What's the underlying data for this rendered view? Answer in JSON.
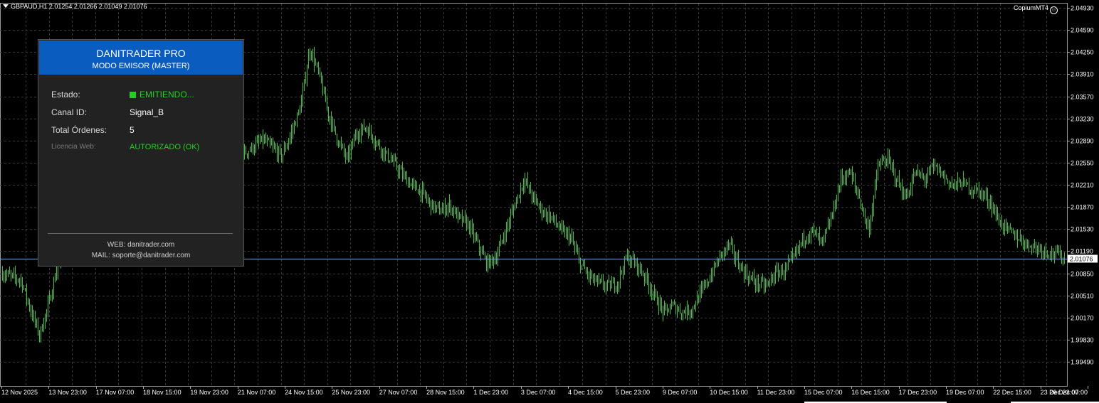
{
  "header": {
    "symbol_line": "GBPAUD,H1  2.01254 2.01266 2.01049 2.01076",
    "brand": "CopiumMT4"
  },
  "panel": {
    "title": "DANITRADER PRO",
    "subtitle": "MODO EMISOR (MASTER)",
    "estado_label": "Estado:",
    "estado_value": "EMITIENDO...",
    "canal_label": "Canal ID:",
    "canal_value": "Signal_B",
    "total_label": "Total Órdenes:",
    "total_value": "5",
    "licencia_label": "Licencia Web:",
    "licencia_value": "AUTORIZADO (OK)",
    "web": "WEB: danitrader.com",
    "mail": "MAIL: soporte@danitrader.com"
  },
  "colors": {
    "background": "#000000",
    "grid": "#3a3a3a",
    "bars": "#22d022",
    "price_line": "#7fa6c8",
    "panel_head": "#0b5cbf",
    "status_green": "#22d022"
  },
  "chart_data": {
    "type": "bar",
    "title": "GBPAUD,H1",
    "current_price": "2.01076",
    "y_ticks": [
      "2.04930",
      "2.04590",
      "2.04250",
      "2.03910",
      "2.03570",
      "2.03230",
      "2.02890",
      "2.02550",
      "2.02210",
      "2.01870",
      "2.01530",
      "2.01190",
      "2.00850",
      "2.00510",
      "2.00170",
      "1.99830",
      "1.99490"
    ],
    "ylim": [
      1.9949,
      2.0493
    ],
    "x_labels": [
      "12 Nov 2025",
      "13 Nov 23:00",
      "17 Nov 07:00",
      "18 Nov 15:00",
      "19 Nov 23:00",
      "21 Nov 07:00",
      "24 Nov 15:00",
      "25 Nov 23:00",
      "27 Nov 07:00",
      "28 Nov 15:00",
      "1 Dec 23:00",
      "3 Dec 07:00",
      "4 Dec 15:00",
      "5 Dec 23:00",
      "9 Dec 07:00",
      "10 Dec 15:00",
      "11 Dec 23:00",
      "15 Dec 07:00",
      "16 Dec 15:00",
      "17 Dec 23:00",
      "19 Dec 07:00",
      "22 Dec 15:00",
      "23 Dec 23:00",
      "26 Dec 07:00"
    ],
    "close_path": [
      [
        0,
        2.0085
      ],
      [
        2,
        2.0075
      ],
      [
        3,
        2.003
      ],
      [
        4,
        1.999
      ],
      [
        5,
        2.004
      ],
      [
        6,
        2.01
      ],
      [
        8,
        2.013
      ],
      [
        10,
        2.012
      ],
      [
        12,
        2.014
      ],
      [
        14,
        2.018
      ],
      [
        16,
        2.023
      ],
      [
        18,
        2.026
      ],
      [
        20,
        2.028
      ],
      [
        22,
        2.03
      ],
      [
        24,
        2.0275
      ],
      [
        26,
        2.027
      ],
      [
        28,
        2.029
      ],
      [
        30,
        2.0265
      ],
      [
        31,
        2.03
      ],
      [
        32,
        2.034
      ],
      [
        33,
        2.043
      ],
      [
        34,
        2.039
      ],
      [
        35,
        2.033
      ],
      [
        36,
        2.029
      ],
      [
        37,
        2.026
      ],
      [
        38,
        2.03
      ],
      [
        39,
        2.031
      ],
      [
        40,
        2.029
      ],
      [
        41,
        2.027
      ],
      [
        42,
        2.0255
      ],
      [
        43,
        2.0235
      ],
      [
        44,
        2.022
      ],
      [
        45,
        2.021
      ],
      [
        46,
        2.019
      ],
      [
        47,
        2.018
      ],
      [
        48,
        2.019
      ],
      [
        49,
        2.017
      ],
      [
        50,
        2.016
      ],
      [
        51,
        2.013
      ],
      [
        52,
        2.01
      ],
      [
        53,
        2.011
      ],
      [
        54,
        2.015
      ],
      [
        55,
        2.019
      ],
      [
        56,
        2.023
      ],
      [
        57,
        2.02
      ],
      [
        58,
        2.018
      ],
      [
        59,
        2.017
      ],
      [
        60,
        2.015
      ],
      [
        61,
        2.014
      ],
      [
        62,
        2.01
      ],
      [
        63,
        2.008
      ],
      [
        64,
        2.007
      ],
      [
        65,
        2.0065
      ],
      [
        66,
        2.007
      ],
      [
        67,
        2.011
      ],
      [
        68,
        2.01
      ],
      [
        69,
        2.008
      ],
      [
        70,
        2.005
      ],
      [
        71,
        2.0025
      ],
      [
        72,
        2.0035
      ],
      [
        73,
        2.0025
      ],
      [
        74,
        2.003
      ],
      [
        75,
        2.0055
      ],
      [
        76,
        2.008
      ],
      [
        77,
        2.011
      ],
      [
        78,
        2.013
      ],
      [
        79,
        2.01
      ],
      [
        80,
        2.008
      ],
      [
        81,
        2.007
      ],
      [
        82,
        2.0065
      ],
      [
        83,
        2.0085
      ],
      [
        84,
        2.009
      ],
      [
        85,
        2.011
      ],
      [
        86,
        2.014
      ],
      [
        87,
        2.015
      ],
      [
        88,
        2.013
      ],
      [
        89,
        2.017
      ],
      [
        90,
        2.023
      ],
      [
        91,
        2.024
      ],
      [
        92,
        2.02
      ],
      [
        93,
        2.015
      ],
      [
        94,
        2.025
      ],
      [
        95,
        2.026
      ],
      [
        96,
        2.023
      ],
      [
        97,
        2.02
      ],
      [
        98,
        2.024
      ],
      [
        99,
        2.023
      ],
      [
        100,
        2.025
      ],
      [
        101,
        2.0235
      ],
      [
        102,
        2.022
      ],
      [
        103,
        2.0225
      ],
      [
        104,
        2.0215
      ],
      [
        105,
        2.021
      ],
      [
        106,
        2.0195
      ],
      [
        107,
        2.0165
      ],
      [
        108,
        2.015
      ],
      [
        109,
        2.014
      ],
      [
        110,
        2.013
      ],
      [
        111,
        2.0125
      ],
      [
        112,
        2.012
      ],
      [
        113,
        2.0115
      ],
      [
        114,
        2.011
      ]
    ]
  }
}
